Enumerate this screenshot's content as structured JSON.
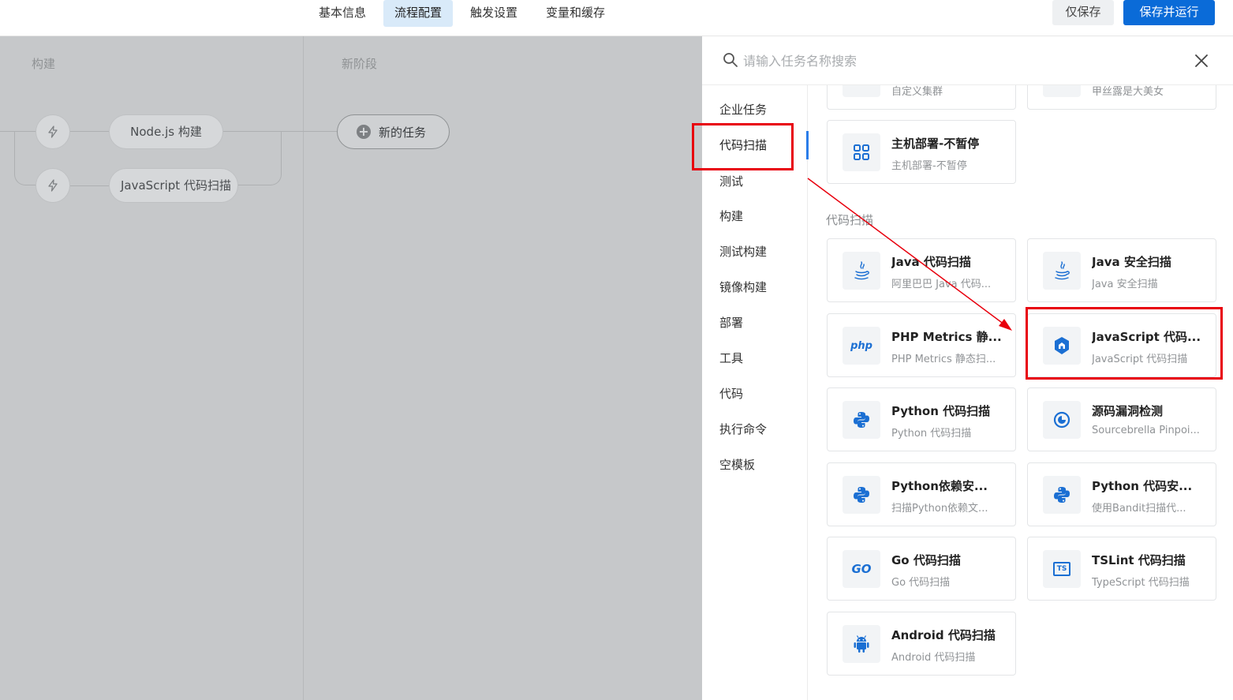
{
  "header": {
    "tabs": [
      {
        "label": "基本信息"
      },
      {
        "label": "流程配置"
      },
      {
        "label": "触发设置"
      },
      {
        "label": "变量和缓存"
      }
    ],
    "save_label": "仅保存",
    "run_label": "保存并运行"
  },
  "pipeline": {
    "stages": [
      {
        "title": "构建",
        "jobs": [
          "Node.js 构建",
          "JavaScript 代码扫描"
        ]
      },
      {
        "title": "新阶段"
      }
    ],
    "new_task_label": "新的任务"
  },
  "panel": {
    "search_placeholder": "请输入任务名称搜索",
    "categories": [
      {
        "label": "企业任务"
      },
      {
        "label": "代码扫描"
      },
      {
        "label": "测试"
      },
      {
        "label": "构建"
      },
      {
        "label": "测试构建"
      },
      {
        "label": "镜像构建"
      },
      {
        "label": "部署"
      },
      {
        "label": "工具"
      },
      {
        "label": "代码"
      },
      {
        "label": "执行命令"
      },
      {
        "label": "空模板"
      }
    ],
    "active_category": "代码扫描",
    "top_cards": [
      {
        "title": "",
        "desc": "自定义集群"
      },
      {
        "title": "",
        "desc": "甲丝露是大美女"
      },
      {
        "title": "主机部署-不暂停",
        "desc": "主机部署-不暂停",
        "icon": "grid-icon"
      }
    ],
    "section_title": "代码扫描",
    "cards": [
      {
        "title": "Java 代码扫描",
        "desc": "阿里巴巴 Java 代码...",
        "icon": "java-icon"
      },
      {
        "title": "Java 安全扫描",
        "desc": "Java 安全扫描",
        "icon": "java-icon"
      },
      {
        "title": "PHP Metrics 静...",
        "desc": "PHP Metrics 静态扫...",
        "icon": "php-icon"
      },
      {
        "title": "JavaScript 代码...",
        "desc": "JavaScript 代码扫描",
        "icon": "js-shield-icon"
      },
      {
        "title": "Python 代码扫描",
        "desc": "Python 代码扫描",
        "icon": "python-icon"
      },
      {
        "title": "源码漏洞检测",
        "desc": "Sourcebrella Pinpoi...",
        "icon": "pinpoint-icon"
      },
      {
        "title": "Python依赖安...",
        "desc": "扫描Python依赖文...",
        "icon": "python-icon"
      },
      {
        "title": "Python 代码安...",
        "desc": "使用Bandit扫描代...",
        "icon": "python-icon"
      },
      {
        "title": "Go 代码扫描",
        "desc": "Go 代码扫描",
        "icon": "go-icon"
      },
      {
        "title": "TSLint 代码扫描",
        "desc": "TypeScript 代码扫描",
        "icon": "ts-icon"
      },
      {
        "title": "Android 代码扫描",
        "desc": "Android 代码扫描",
        "icon": "android-icon"
      }
    ],
    "icon_labels": {
      "php": "php",
      "go": "GO",
      "ts": "TS"
    }
  },
  "colors": {
    "primary": "#0a6bd8",
    "accent_blue": "#1b6fd3",
    "annotation_red": "#e8000d",
    "active_tab_bg": "#d9eaf9"
  }
}
